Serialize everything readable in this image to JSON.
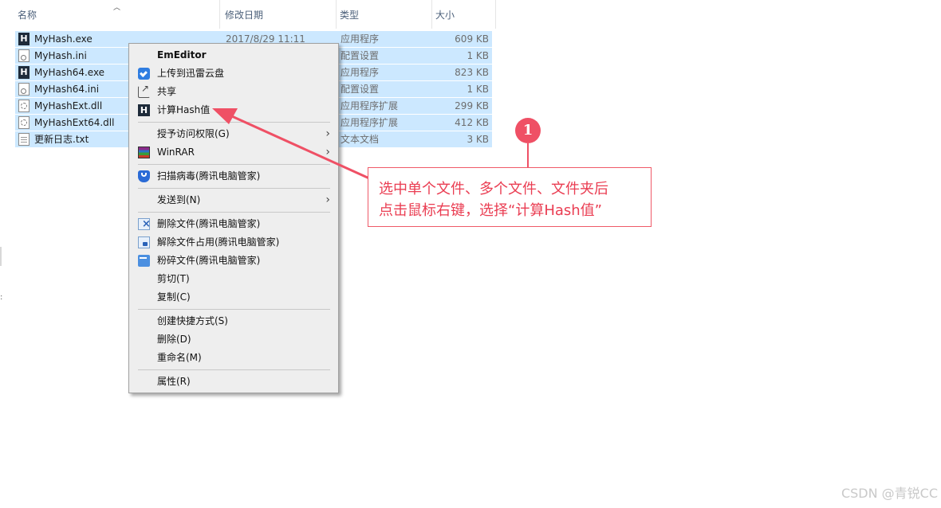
{
  "columns": {
    "name": "名称",
    "date": "修改日期",
    "type": "类型",
    "size": "大小",
    "sort_icon": "chevron-up-icon"
  },
  "files": [
    {
      "name": "MyHash.exe",
      "date": "2017/8/29 11:11",
      "type": "应用程序",
      "size": "609 KB",
      "icon": "app-icon"
    },
    {
      "name": "MyHash.ini",
      "date": "",
      "type": "配置设置",
      "size": "1 KB",
      "icon": "config-file-icon"
    },
    {
      "name": "MyHash64.exe",
      "date": "",
      "type": "应用程序",
      "size": "823 KB",
      "icon": "app-icon"
    },
    {
      "name": "MyHash64.ini",
      "date": "",
      "type": "配置设置",
      "size": "1 KB",
      "icon": "config-file-icon"
    },
    {
      "name": "MyHashExt.dll",
      "date": "",
      "type": "应用程序扩展",
      "size": "299 KB",
      "icon": "dll-file-icon"
    },
    {
      "name": "MyHashExt64.dll",
      "date": "",
      "type": "应用程序扩展",
      "size": "412 KB",
      "icon": "dll-file-icon"
    },
    {
      "name": "更新日志.txt",
      "date": "",
      "type": "文本文档",
      "size": "3 KB",
      "icon": "text-file-icon"
    }
  ],
  "menu": {
    "emeditor": "EmEditor",
    "upload": "上传到迅雷云盘",
    "share": "共享",
    "hash": "计算Hash值",
    "grant": "授予访问权限(G)",
    "winrar": "WinRAR",
    "scan": "扫描病毒(腾讯电脑管家)",
    "sendto": "发送到(N)",
    "delete_file": "删除文件(腾讯电脑管家)",
    "unlock_file": "解除文件占用(腾讯电脑管家)",
    "shred_file": "粉碎文件(腾讯电脑管家)",
    "cut": "剪切(T)",
    "copy": "复制(C)",
    "shortcut": "创建快捷方式(S)",
    "delete": "删除(D)",
    "rename": "重命名(M)",
    "properties": "属性(R)",
    "hash_icon_letter": "H",
    "submenu_arrow": "›"
  },
  "callout": {
    "badge": "1",
    "line1": "选中单个文件、多个文件、文件夹后",
    "line2": "点击鼠标右键，选择“计算Hash值”",
    "color": "#ea3d52"
  },
  "watermark": "CSDN @青锐CC",
  "side_marker": ":"
}
